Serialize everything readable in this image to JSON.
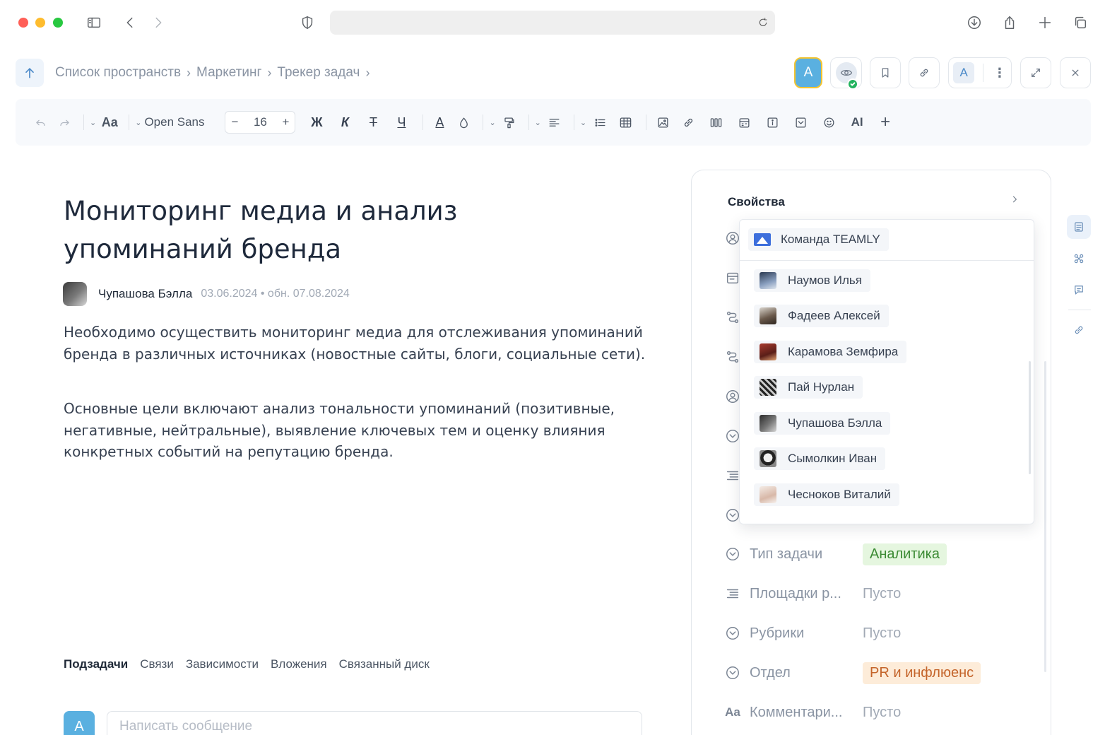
{
  "breadcrumb": {
    "items": [
      "Список пространств",
      "Маркетинг",
      "Трекер задач"
    ],
    "separator": "›"
  },
  "header": {
    "avatar_letter": "A",
    "font_letter": "A",
    "kebab": "⋮"
  },
  "toolbar": {
    "text_style_label": "Aa",
    "font_family": "Open Sans",
    "font_size": "16",
    "minus": "−",
    "plus": "+",
    "bold": "Ж",
    "italic": "К",
    "strike": "Т",
    "underline": "Ч",
    "text_color": "A",
    "ai_label": "AI",
    "insert": "+"
  },
  "document": {
    "title": "Мониторинг медиа и анализ упоминаний бренда",
    "author": "Чупашова Бэлла",
    "dates": "03.06.2024 • обн. 07.08.2024",
    "paragraph1": "Необходимо осуществить мониторинг медиа для отслеживания упоминаний бренда в различных источниках (новостные сайты, блоги, социальные сети).",
    "paragraph2": "Основные цели включают анализ тональности упоминаний (позитивные, негативные, нейтральные), выявление ключевых тем и оценку влияния конкретных событий на репутацию бренда."
  },
  "tabs": [
    "Подзадачи",
    "Связи",
    "Зависимости",
    "Вложения",
    "Связанный диск"
  ],
  "message": {
    "avatar_letter": "A",
    "placeholder": "Написать сообщение"
  },
  "properties": {
    "title": "Свойства",
    "rows": [
      {
        "label": "Тип задачи",
        "value": "Аналитика",
        "style": "tag-green"
      },
      {
        "label": "Площадки р...",
        "value": "Пусто",
        "style": "empty"
      },
      {
        "label": "Рубрики",
        "value": "Пусто",
        "style": "empty"
      },
      {
        "label": "Отдел",
        "value": "PR и инфлюенс",
        "style": "tag-orange"
      },
      {
        "label": "Комментари...",
        "value": "Пусто",
        "style": "empty"
      }
    ],
    "comment_icon_text": "Aa"
  },
  "dropdown": {
    "team": "Команда TEAMLY",
    "people": [
      "Наумов Илья",
      "Фадеев Алексей",
      "Карамова Земфира",
      "Пай Нурлан",
      "Чупашова Бэлла",
      "Сымолкин Иван",
      "Чесноков Виталий"
    ]
  },
  "colors": {
    "accent": "#4a89c8",
    "avatar_blue": "#5ab0e0",
    "tag_green_bg": "#e5f6df",
    "tag_orange_bg": "#fdecd9",
    "online_green": "#22b35e"
  }
}
